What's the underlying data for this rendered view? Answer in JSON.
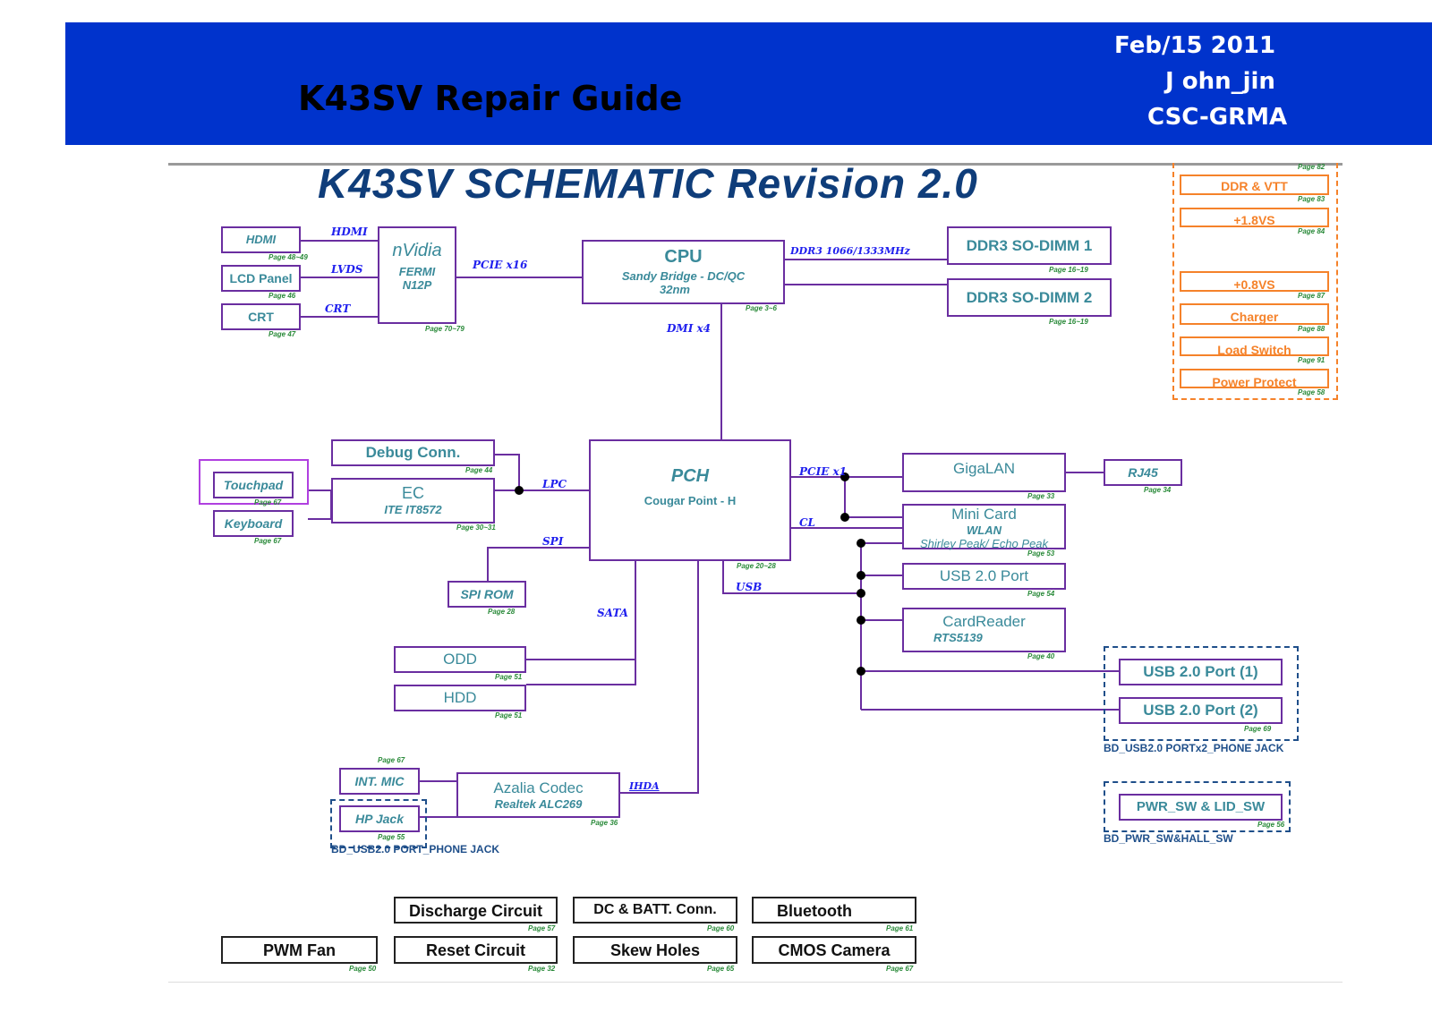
{
  "header": {
    "title": "K43SV Repair Guide",
    "date": "Feb/15 2011",
    "author": "J ohn_jin",
    "dept": "CSC-GRMA"
  },
  "schematic": {
    "title": "K43SV SCHEMATIC Revision 2.0",
    "blocks": {
      "hdmi": {
        "title": "HDMI",
        "page": "Page 48~49"
      },
      "lcd": {
        "title": "LCD Panel",
        "page": "Page 46"
      },
      "crt": {
        "title": "CRT",
        "page": "Page 47"
      },
      "nvidia": {
        "title": "nVidia",
        "sub1": "FERMI",
        "sub2": "N12P",
        "page": "Page 70~79"
      },
      "cpu": {
        "title": "CPU",
        "sub1": "Sandy Bridge - DC/QC",
        "sub2": "32nm",
        "page": "Page 3~6"
      },
      "dimm1": {
        "title": "DDR3 SO-DIMM 1",
        "page": "Page 16~19"
      },
      "dimm2": {
        "title": "DDR3 SO-DIMM 2",
        "page": "Page 16~19"
      },
      "debug": {
        "title": "Debug Conn.",
        "page": "Page 44"
      },
      "touchpad": {
        "title": "Touchpad",
        "page": "Page 67"
      },
      "keyboard": {
        "title": "Keyboard",
        "page": "Page 67"
      },
      "ec": {
        "title": "EC",
        "sub1": "ITE IT8572",
        "page": "Page 30~31"
      },
      "pch": {
        "title": "PCH",
        "sub1": "Cougar Point - H",
        "page": "Page 20~28"
      },
      "spirom": {
        "title": "SPI ROM",
        "page": "Page 28"
      },
      "odd": {
        "title": "ODD",
        "page": "Page 51"
      },
      "hdd": {
        "title": "HDD",
        "page": "Page 51"
      },
      "gigalan": {
        "title": "GigaLAN",
        "page": "Page 33"
      },
      "rj45": {
        "title": "RJ45",
        "page": "Page 34"
      },
      "minicard": {
        "title": "Mini Card",
        "sub1": "WLAN",
        "sub2": "Shirley Peak/ Echo Peak",
        "page": "Page 53"
      },
      "usbport": {
        "title": "USB 2.0 Port",
        "page": "Page 54"
      },
      "cardreader": {
        "title": "CardReader",
        "sub1": "RTS5139",
        "page": "Page 40"
      },
      "usb1": {
        "title": "USB 2.0 Port (1)"
      },
      "usb2": {
        "title": "USB 2.0 Port (2)",
        "page": "Page 69"
      },
      "pwrsw": {
        "title": "PWR_SW & LID_SW",
        "page": "Page 56"
      },
      "intmic": {
        "title": "INT. MIC",
        "page": "Page 67"
      },
      "hpjack": {
        "title": "HP Jack",
        "page": "Page 55"
      },
      "azalia": {
        "title": "Azalia Codec",
        "sub1": "Realtek ALC269",
        "page": "Page 36"
      }
    },
    "buses": {
      "hdmi": "HDMI",
      "lvds": "LVDS",
      "crt": "CRT",
      "pcie16": "PCIE x16",
      "ddr3": "DDR3 1066/1333MHz",
      "dmi": "DMI x4",
      "lpc": "LPC",
      "spi": "SPI",
      "sata": "SATA",
      "pcie1": "PCIE x1",
      "cl": "CL",
      "usb": "USB",
      "ihda": "IHDA"
    },
    "board_labels": {
      "usb_board": "BD_USB2.0 PORTx2_PHONE JACK",
      "pwr_board": "BD_PWR_SW&HALL_SW",
      "phone_board": "BD_USB2.0 PORT_PHONE JACK"
    },
    "power": [
      {
        "title": "DDR & VTT",
        "page": "Page 82"
      },
      {
        "title": "+1.8VS",
        "page": "Page 83"
      },
      {
        "title": "+0.8VS",
        "page": "Page 84"
      },
      {
        "title": "Charger",
        "page": "Page 87"
      },
      {
        "title": "Load Switch",
        "page": "Page 88"
      },
      {
        "title": "Power Protect",
        "page": "Page 91"
      }
    ],
    "power_last_page": "Page 58",
    "misc": [
      {
        "title": "Discharge Circuit",
        "page": "Page 57"
      },
      {
        "title": "DC & BATT. Conn.",
        "page": "Page 60"
      },
      {
        "title": "Bluetooth",
        "page": "Page 61"
      },
      {
        "title": "PWM Fan",
        "page": "Page 50"
      },
      {
        "title": "Reset Circuit",
        "page": "Page 32"
      },
      {
        "title": "Skew Holes",
        "page": "Page 65"
      },
      {
        "title": "CMOS Camera",
        "page": "Page 67"
      }
    ]
  }
}
